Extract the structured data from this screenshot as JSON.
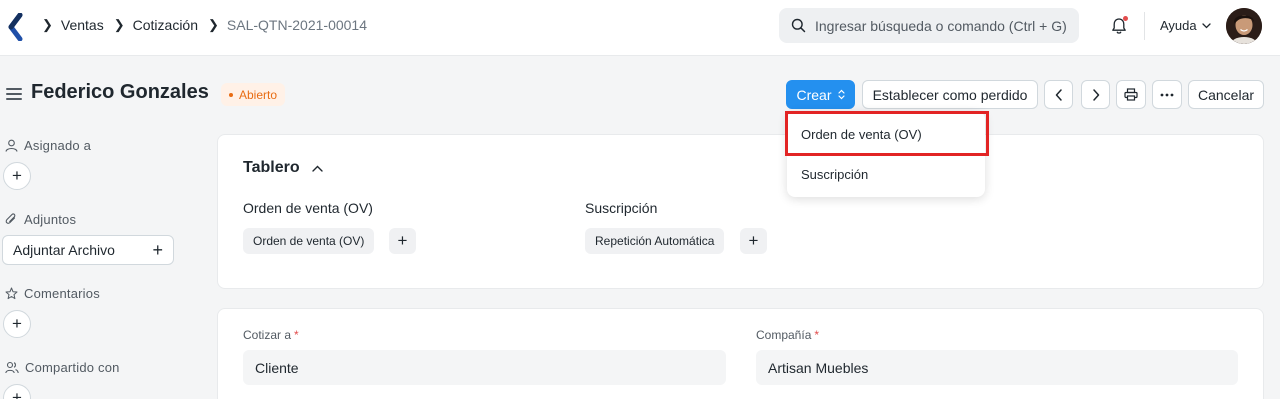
{
  "navbar": {
    "breadcrumbs": [
      "Ventas",
      "Cotización",
      "SAL-QTN-2021-00014"
    ],
    "search_placeholder": "Ingresar búsqueda o comando (Ctrl + G)",
    "help_label": "Ayuda",
    "icons": {
      "logo": "logo-icon",
      "search": "search-icon",
      "bell": "bell-icon",
      "chevron": "chevron-down-icon"
    }
  },
  "header": {
    "title": "Federico Gonzales",
    "status": "Abierto",
    "status_color": "#e86c13",
    "buttons": {
      "create": "Crear",
      "set_lost": "Establecer como perdido",
      "cancel": "Cancelar"
    },
    "accent": "#2490ef"
  },
  "create_menu": {
    "items": [
      "Orden de venta (OV)",
      "Suscripción"
    ],
    "highlighted_item": "Orden de venta (OV)",
    "highlight_color": "#e22424"
  },
  "sidebar": {
    "assigned_to": "Asignado a",
    "attachments": "Adjuntos",
    "attach_file": "Adjuntar Archivo",
    "comments": "Comentarios",
    "shared_with": "Compartido con"
  },
  "dashboard": {
    "title": "Tablero",
    "groups": [
      {
        "label": "Orden de venta (OV)",
        "chip": "Orden de venta (OV)"
      },
      {
        "label": "Suscripción",
        "chip": "Repetición Automática"
      }
    ]
  },
  "form": {
    "quote_to_label": "Cotizar a",
    "quote_to_value": "Cliente",
    "company_label": "Compañía",
    "company_value": "Artisan Muebles",
    "required_marker": "*"
  }
}
